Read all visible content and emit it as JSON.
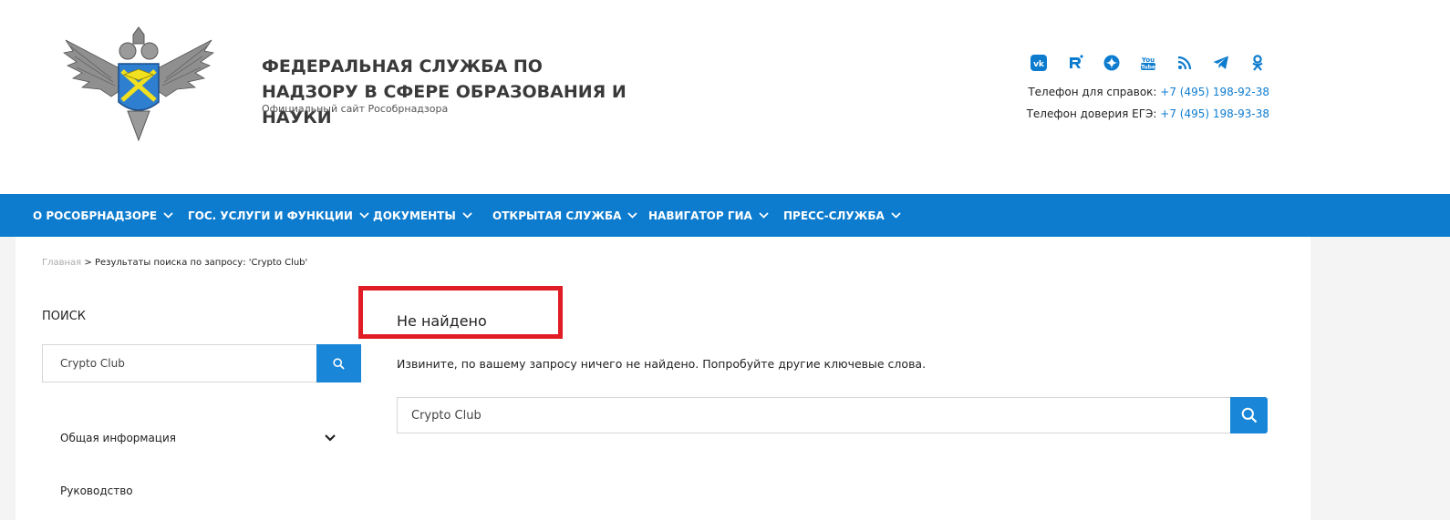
{
  "header": {
    "title": "Федеральная служба по надзору в сфере образования и науки",
    "subtitle": "Официальный сайт Рособрнадзора",
    "social_icons": [
      "vk-icon",
      "rutube-icon",
      "dzen-icon",
      "youtube-icon",
      "rss-icon",
      "telegram-icon",
      "odnoklassniki-icon"
    ],
    "phone_info_label": "Телефон для справок: ",
    "phone_info_number": "+7 (495) 198-92-38",
    "phone_ege_label": "Телефон доверия ЕГЭ: ",
    "phone_ege_number": "+7 (495) 198-93-38"
  },
  "nav": {
    "items": [
      {
        "label": "О РОСОБРНАДЗОРЕ"
      },
      {
        "label": "ГОС. УСЛУГИ И ФУНКЦИИ"
      },
      {
        "label": "ДОКУМЕНТЫ"
      },
      {
        "label": "ОТКРЫТАЯ СЛУЖБА"
      },
      {
        "label": "НАВИГАТОР ГИА"
      },
      {
        "label": "ПРЕСС-СЛУЖБА"
      }
    ]
  },
  "breadcrumb": {
    "home": "Главная",
    "separator": " > ",
    "current": "Результаты поиска по запросу: 'Crypto Club'"
  },
  "sidebar": {
    "heading": "ПОИСК",
    "search_value": "Crypto Club",
    "menu": [
      {
        "label": "Общая информация"
      },
      {
        "label": "Руководство"
      }
    ]
  },
  "main": {
    "not_found_title": "Не найдено",
    "message": "Извините, по вашему запросу ничего не найдено. Попробуйте другие ключевые слова.",
    "search_value": "Crypto Club"
  },
  "colors": {
    "brand_blue": "#0d7ccf",
    "button_blue": "#1a86d8",
    "highlight_red": "#e01d25"
  }
}
